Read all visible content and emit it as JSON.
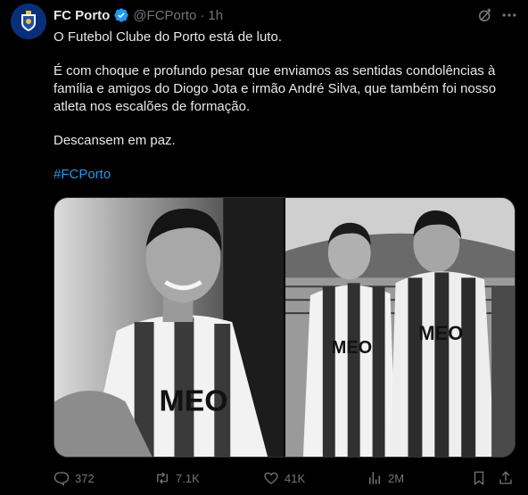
{
  "author": {
    "name": "FC Porto",
    "handle": "@FCPorto",
    "separator": "·",
    "time": "1h",
    "verified": true,
    "avatar_icon": "fc-porto-crest-icon"
  },
  "header_icons": [
    "grok-icon",
    "more-icon"
  ],
  "post": {
    "line1": "O Futebol Clube do Porto está de luto.",
    "paragraph2": "É com choque e profundo pesar que enviamos as sentidas condolências à família e amigos do Diogo Jota e irmão André Silva, que também foi nosso atleta nos escalões de formação.",
    "line3": "Descansem em paz.",
    "hashtag": "#FCPorto"
  },
  "media": {
    "count": 2,
    "style": "black-and-white photographs",
    "jersey_sponsor": "MEO"
  },
  "actions": {
    "replies": "372",
    "reposts": "7.1K",
    "likes": "41K",
    "views": "2M"
  },
  "colors": {
    "background": "#000000",
    "text": "#e7e9ea",
    "muted": "#71767b",
    "link": "#1d9bf0",
    "verified": "#1d9bf0"
  }
}
